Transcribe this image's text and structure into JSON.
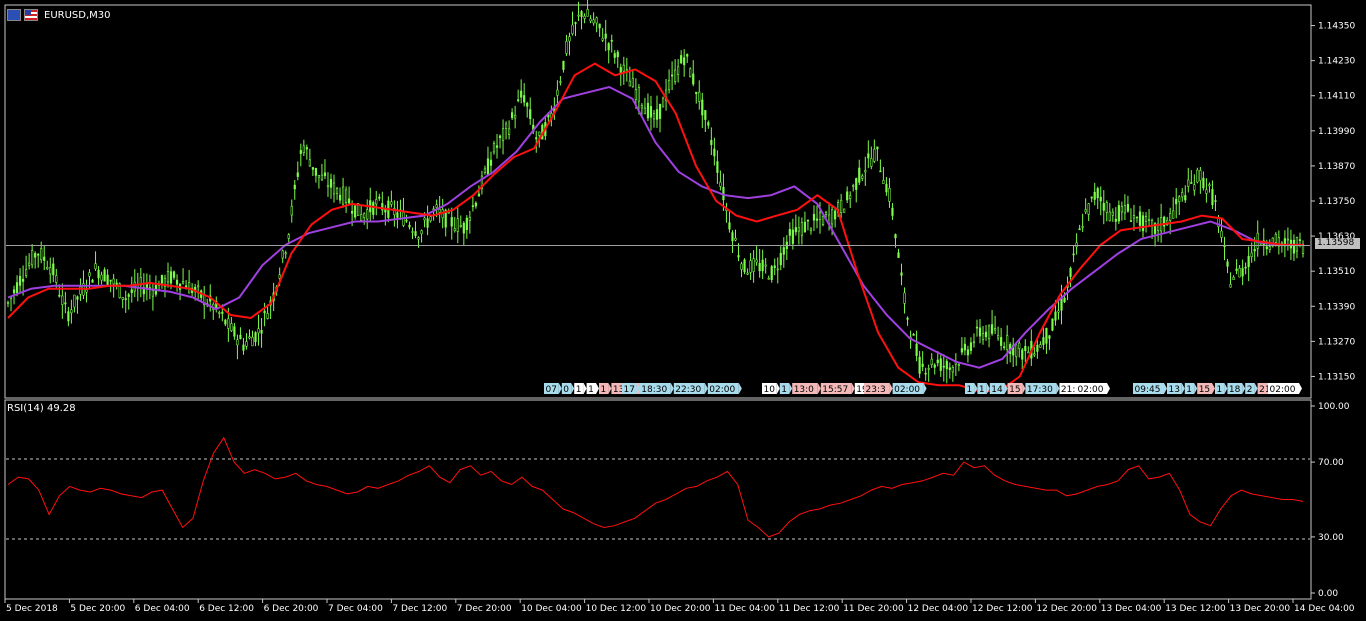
{
  "window": {
    "symbol": "EURUSD,M30"
  },
  "current_price": "1.13598",
  "price_axis": [
    "1.14350",
    "1.14230",
    "1.14110",
    "1.13990",
    "1.13870",
    "1.13750",
    "1.13630",
    "1.13510",
    "1.13390",
    "1.13270",
    "1.13150"
  ],
  "rsi": {
    "label": "RSI(14) 49.28",
    "levels": [
      "100.00",
      "70.00",
      "30.00",
      "0.00"
    ]
  },
  "time_axis": [
    "5 Dec 2018",
    "5 Dec 20:00",
    "6 Dec 04:00",
    "6 Dec 12:00",
    "6 Dec 20:00",
    "7 Dec 04:00",
    "7 Dec 12:00",
    "7 Dec 20:00",
    "10 Dec 04:00",
    "10 Dec 12:00",
    "10 Dec 20:00",
    "11 Dec 04:00",
    "11 Dec 12:00",
    "11 Dec 20:00",
    "12 Dec 04:00",
    "12 Dec 12:00",
    "12 Dec 20:00",
    "13 Dec 04:00",
    "13 Dec 12:00",
    "13 Dec 20:00",
    "14 Dec 04:00"
  ],
  "event_markers": [
    {
      "text": "07",
      "color": "#a8dcec"
    },
    {
      "text": "0",
      "color": "#a8dcec"
    },
    {
      "text": "1",
      "color": "#ffffff"
    },
    {
      "text": "1",
      "color": "#ffffff"
    },
    {
      "text": "1",
      "color": "#f4b8b8"
    },
    {
      "text": "13:00",
      "color": "#f4b8b8"
    },
    {
      "text": "17",
      "color": "#a8dcec"
    },
    {
      "text": "18:30",
      "color": "#a8dcec"
    },
    {
      "text": "22:30",
      "color": "#a8dcec"
    },
    {
      "text": "02:00",
      "color": "#a8dcec"
    },
    {
      "text": "10",
      "color": "#ffffff"
    },
    {
      "text": "1",
      "color": "#a8dcec"
    },
    {
      "text": "13:0",
      "color": "#f4b8b8"
    },
    {
      "text": "15:57",
      "color": "#f4b8b8"
    },
    {
      "text": "19:00",
      "color": "#ffffff"
    },
    {
      "text": "23:3",
      "color": "#f4b8b8"
    },
    {
      "text": "02:00",
      "color": "#a8dcec"
    },
    {
      "text": "1",
      "color": "#a8dcec"
    },
    {
      "text": "1",
      "color": "#a8dcec"
    },
    {
      "text": "14",
      "color": "#a8dcec"
    },
    {
      "text": "15",
      "color": "#f4b8b8"
    },
    {
      "text": "17:30",
      "color": "#a8dcec"
    },
    {
      "text": "21:00",
      "color": "#ffffff"
    },
    {
      "text": "02:00",
      "color": "#ffffff"
    },
    {
      "text": "09:45",
      "color": "#a8dcec"
    },
    {
      "text": "13",
      "color": "#a8dcec"
    },
    {
      "text": "1",
      "color": "#a8dcec"
    },
    {
      "text": "15",
      "color": "#f4b8b8"
    },
    {
      "text": "1",
      "color": "#a8dcec"
    },
    {
      "text": "18",
      "color": "#a8dcec"
    },
    {
      "text": "2",
      "color": "#a8dcec"
    },
    {
      "text": "21:00",
      "color": "#f4b8b8"
    },
    {
      "text": "02:00",
      "color": "#ffffff"
    }
  ],
  "colors": {
    "candles": "#7cfc4a",
    "ma_fast": "#ff1010",
    "ma_slow": "#a040e0",
    "rsi": "#ff1010",
    "frame": "#c8c8c8",
    "price_line": "#a0a0a0"
  },
  "chart_data": {
    "type": "line",
    "series_price": [
      1.134,
      1.135,
      1.1358,
      1.1352,
      1.1336,
      1.1344,
      1.1352,
      1.1348,
      1.1342,
      1.1346,
      1.1345,
      1.1349,
      1.1347,
      1.1343,
      1.1339,
      1.1332,
      1.1326,
      1.133,
      1.1342,
      1.1362,
      1.1395,
      1.1384,
      1.138,
      1.1376,
      1.137,
      1.1374,
      1.1372,
      1.1369,
      1.1364,
      1.1372,
      1.1368,
      1.1366,
      1.1378,
      1.1392,
      1.14,
      1.1412,
      1.1395,
      1.1405,
      1.1428,
      1.144,
      1.1435,
      1.1428,
      1.1418,
      1.141,
      1.1402,
      1.1415,
      1.1425,
      1.141,
      1.1392,
      1.1368,
      1.1352,
      1.1353,
      1.135,
      1.1362,
      1.1366,
      1.1368,
      1.137,
      1.1375,
      1.1385,
      1.1392,
      1.1375,
      1.1338,
      1.1318,
      1.132,
      1.1318,
      1.1323,
      1.133,
      1.133,
      1.1326,
      1.1323,
      1.1325,
      1.1332,
      1.1345,
      1.1368,
      1.1378,
      1.137,
      1.1372,
      1.1368,
      1.1365,
      1.137,
      1.1378,
      1.1384,
      1.1375,
      1.1348,
      1.1352,
      1.1362,
      1.1361,
      1.136,
      1.136
    ],
    "series_ma_fast": [
      1.1335,
      1.1342,
      1.1345,
      1.1345,
      1.1345,
      1.1346,
      1.1346,
      1.1347,
      1.1346,
      1.1345,
      1.1342,
      1.1336,
      1.1335,
      1.134,
      1.1357,
      1.1367,
      1.1372,
      1.1374,
      1.1373,
      1.1372,
      1.1371,
      1.137,
      1.1372,
      1.1377,
      1.1384,
      1.139,
      1.1393,
      1.1405,
      1.1418,
      1.1422,
      1.1418,
      1.142,
      1.1416,
      1.1405,
      1.1387,
      1.1375,
      1.137,
      1.1368,
      1.137,
      1.1372,
      1.1377,
      1.1372,
      1.135,
      1.133,
      1.1318,
      1.1313,
      1.1312,
      1.1312,
      1.131,
      1.131,
      1.1315,
      1.133,
      1.1343,
      1.1352,
      1.136,
      1.1365,
      1.1366,
      1.1367,
      1.1368,
      1.137,
      1.1369,
      1.1362,
      1.1361,
      1.136,
      1.136
    ],
    "series_ma_slow": [
      1.1342,
      1.1345,
      1.1346,
      1.1346,
      1.1346,
      1.1346,
      1.1345,
      1.1344,
      1.1342,
      1.1338,
      1.1342,
      1.1353,
      1.136,
      1.1364,
      1.1366,
      1.1368,
      1.1368,
      1.1369,
      1.137,
      1.1374,
      1.138,
      1.1385,
      1.1392,
      1.1402,
      1.141,
      1.1412,
      1.1414,
      1.141,
      1.1395,
      1.1385,
      1.138,
      1.1377,
      1.1376,
      1.1377,
      1.138,
      1.1374,
      1.136,
      1.1346,
      1.1336,
      1.1328,
      1.1324,
      1.132,
      1.1318,
      1.1321,
      1.133,
      1.1338,
      1.1345,
      1.1351,
      1.1357,
      1.1362,
      1.1364,
      1.1366,
      1.1368,
      1.1365,
      1.1361,
      1.136,
      1.136
    ],
    "series_rsi": [
      58,
      62,
      61,
      55,
      42,
      52,
      57,
      55,
      54,
      56,
      55,
      53,
      52,
      51,
      54,
      55,
      45,
      35,
      40,
      60,
      75,
      83,
      70,
      64,
      66,
      64,
      61,
      62,
      64,
      60,
      58,
      57,
      55,
      53,
      54,
      57,
      56,
      58,
      60,
      63,
      65,
      68,
      62,
      59,
      66,
      68,
      63,
      65,
      60,
      58,
      62,
      57,
      55,
      50,
      45,
      43,
      40,
      37,
      35,
      36,
      38,
      40,
      44,
      48,
      50,
      53,
      56,
      57,
      60,
      62,
      65,
      58,
      39,
      35,
      30,
      32,
      38,
      42,
      44,
      45,
      47,
      48,
      50,
      52,
      55,
      57,
      56,
      58,
      59,
      60,
      62,
      64,
      63,
      70,
      67,
      68,
      63,
      60,
      58,
      57,
      56,
      55,
      55,
      52,
      53,
      55,
      57,
      58,
      60,
      66,
      68,
      61,
      62,
      64,
      55,
      42,
      38,
      36,
      45,
      52,
      55,
      53,
      52,
      51,
      50,
      50,
      49
    ]
  }
}
